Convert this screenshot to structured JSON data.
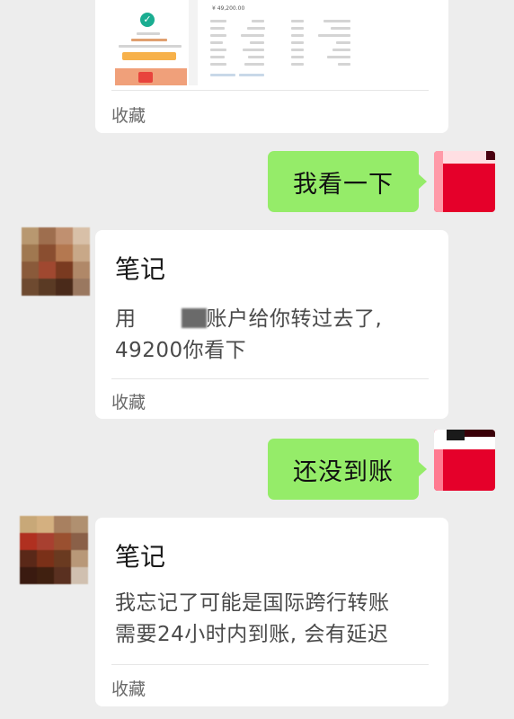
{
  "messages": [
    {
      "type": "note-partial",
      "footer": "收藏",
      "thumbnail": {
        "amount": "¥ 49,200.00"
      }
    },
    {
      "type": "sent",
      "text": "我看一下"
    },
    {
      "type": "note",
      "title": "笔记",
      "body": "用 账户给你转过去了,49200你看下",
      "body_line1": "用",
      "body_line1_after": "账户给你转过去了,",
      "body_line2": "49200你看下",
      "footer": "收藏"
    },
    {
      "type": "sent",
      "text": "还没到账"
    },
    {
      "type": "note",
      "title": "笔记",
      "body_line1": "我忘记了可能是国际跨行转账",
      "body_line2": "需要24小时内到账, 会有延迟",
      "footer": "收藏"
    }
  ],
  "colors": {
    "background": "#ededed",
    "bubble_green": "#95ec69",
    "card": "#ffffff",
    "self_avatar": "#e5002a"
  },
  "icons": {
    "thumb_check": "check-circle-icon"
  }
}
